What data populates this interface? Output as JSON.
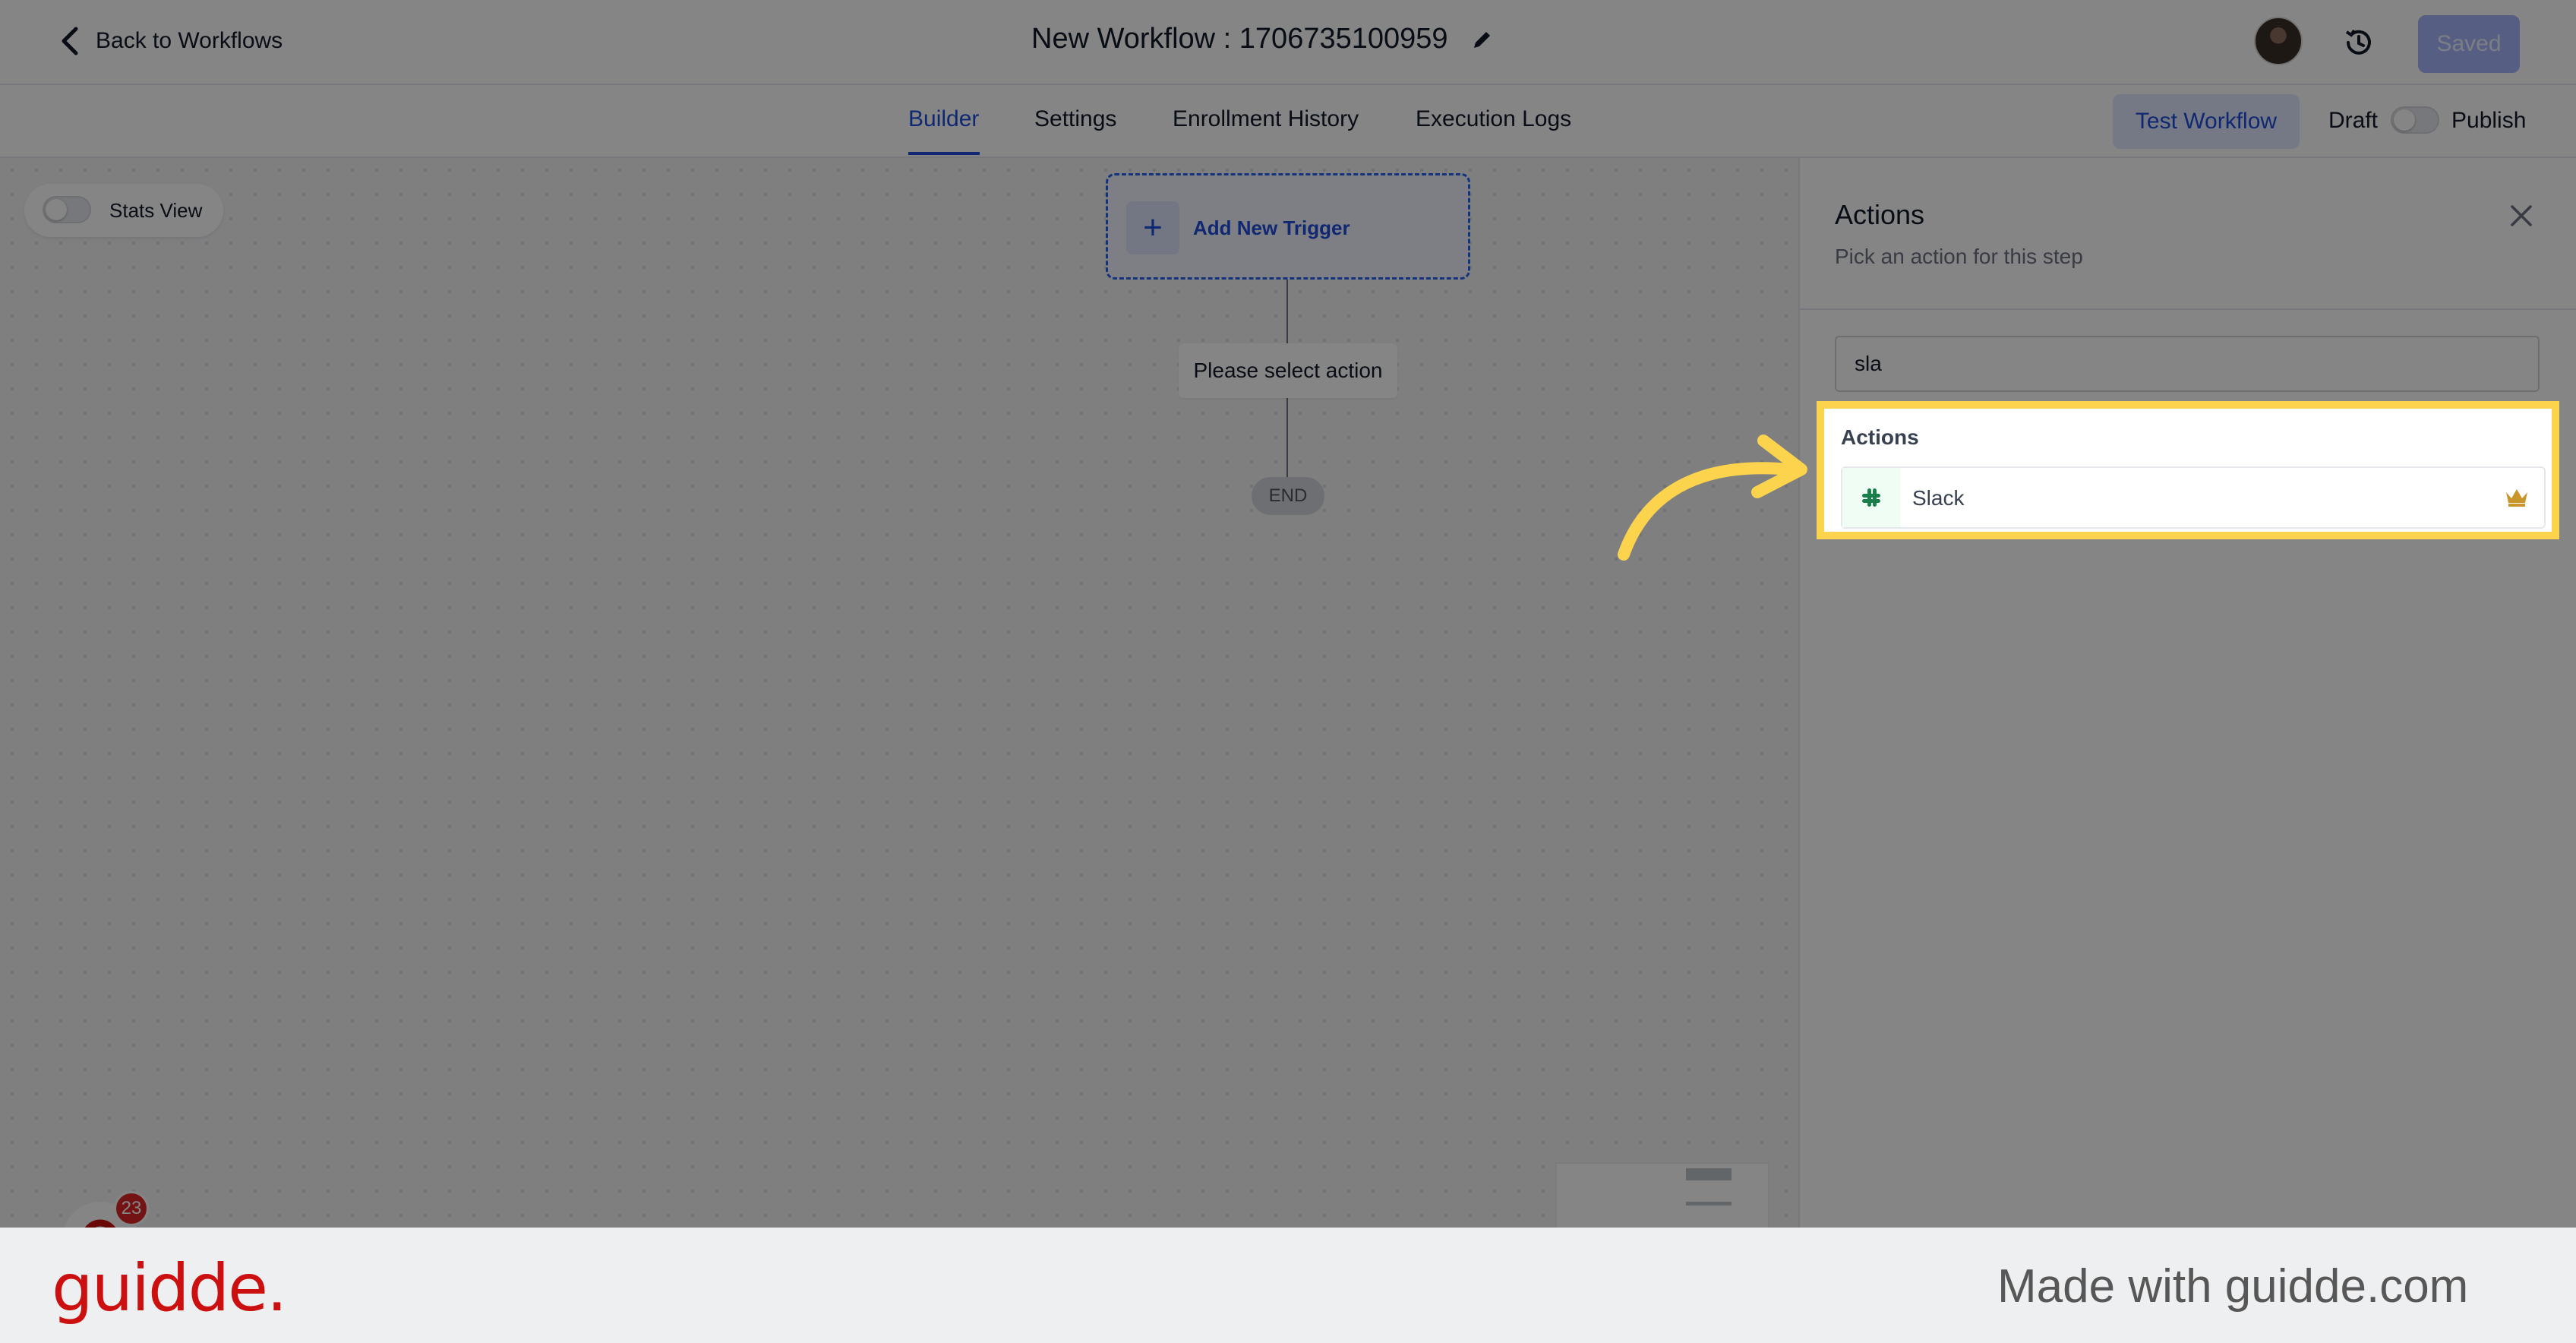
{
  "header": {
    "back_label": "Back to Workflows",
    "workflow_title": "New Workflow : 1706735100959",
    "saved_label": "Saved"
  },
  "tabs": {
    "items": [
      {
        "label": "Builder",
        "active": true
      },
      {
        "label": "Settings",
        "active": false
      },
      {
        "label": "Enrollment History",
        "active": false
      },
      {
        "label": "Execution Logs",
        "active": false
      }
    ],
    "test_workflow_label": "Test Workflow",
    "draft_label": "Draft",
    "publish_label": "Publish",
    "publish_toggle_on": false
  },
  "canvas": {
    "stats_view_label": "Stats View",
    "stats_view_on": false,
    "trigger_label": "Add New Trigger",
    "action_placeholder": "Please select action",
    "end_label": "END",
    "notification_count": "23"
  },
  "panel": {
    "title": "Actions",
    "subtitle": "Pick an action for this step",
    "search_value": "sla",
    "results_section": "Actions",
    "results": [
      {
        "name": "Slack",
        "icon": "slack-icon",
        "premium_icon": "crown-icon"
      }
    ]
  },
  "footer": {
    "brand": "guidde.",
    "made_with": "Made with guidde.com"
  },
  "colors": {
    "accent": "#1d4ed8",
    "highlight": "#fcd34d",
    "brand": "#cc1010"
  }
}
